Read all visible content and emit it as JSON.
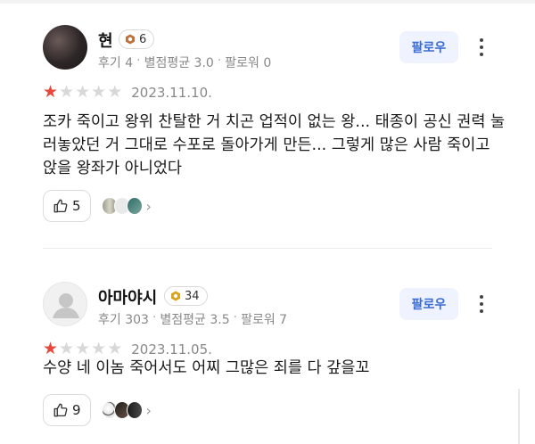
{
  "reviews": [
    {
      "user": "현",
      "level": "6",
      "stats": {
        "reviews": "후기 4",
        "avg_rating": "별점평균 3.0",
        "followers": "팔로워 0"
      },
      "follow_label": "팔로우",
      "stars_filled": 1,
      "stars_total": 5,
      "date": "2023.11.10.",
      "text": "조카 죽이고 왕위 찬탈한 거 치곤 업적이 없는 왕... 태종이 공신 권력 눌러놓았던 거 그대로 수포로 돌아가게 만든... 그렇게 많은 사람 죽이고 앉을 왕좌가 아니었다",
      "likes": "5"
    },
    {
      "user": "아마야시",
      "level": "34",
      "stats": {
        "reviews": "후기 303",
        "avg_rating": "별점평균 3.5",
        "followers": "팔로워 7"
      },
      "follow_label": "팔로우",
      "stars_filled": 1,
      "stars_total": 5,
      "date": "2023.11.05.",
      "text": "수양 네 이놈 죽어서도 어찌 그많은 죄를 다 갚을꼬",
      "likes": "9"
    }
  ],
  "colors": {
    "star_on": "#e8483b",
    "star_off": "#d8d8d8",
    "follow_bg": "#eef3ff",
    "follow_text": "#3a6ad4",
    "badge_r1": "#c0703a",
    "badge_r2": "#d9a21a"
  },
  "icons": {
    "more": "more-vertical-icon",
    "like": "thumbs-up-icon",
    "chevron": "chevron-right-icon",
    "badge": "level-badge-icon"
  }
}
